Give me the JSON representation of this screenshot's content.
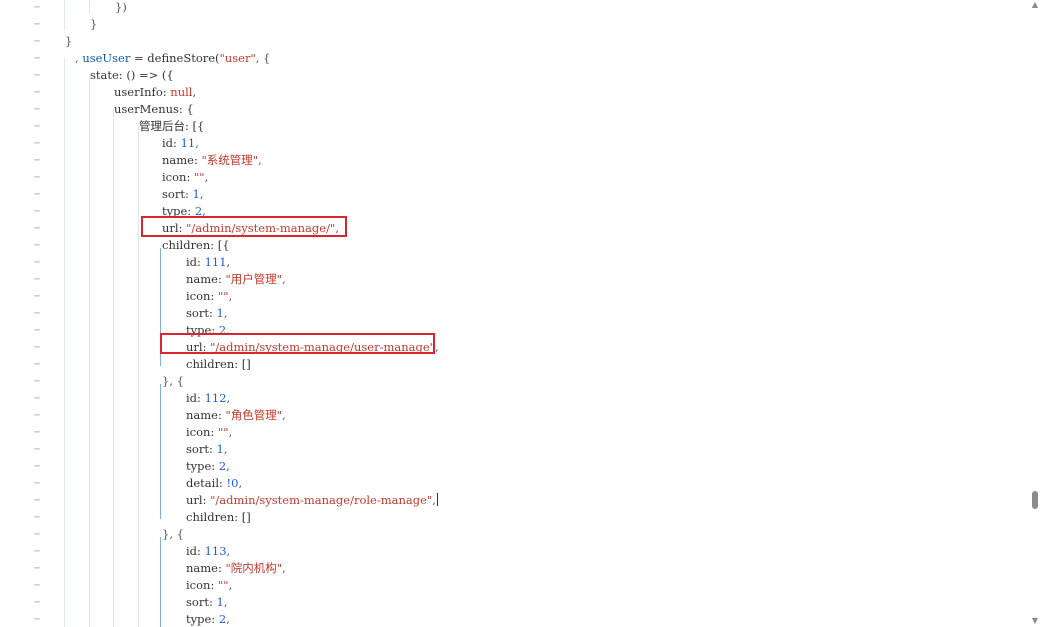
{
  "gutter_marker": "−",
  "scrollbar": {
    "up_glyph": "▲",
    "down_glyph": "▼"
  },
  "code": {
    "l1": "})",
    "l2": "}",
    "l3": "}",
    "l4": {
      "lead": ", ",
      "fn": "useUser",
      "mid": " = defineStore(",
      "str": "\"user\"",
      "tail": ", {"
    },
    "l5": "state: () => ({",
    "l6": {
      "key": "userInfo: ",
      "val": "null",
      "tail": ","
    },
    "l7": "userMenus: {",
    "l8": "管理后台: [{",
    "l9": {
      "key": "id: ",
      "val": "11",
      "tail": ","
    },
    "l10": {
      "key": "name: ",
      "val": "\"系统管理\"",
      "tail": ","
    },
    "l11": {
      "key": "icon: ",
      "val": "\"\"",
      "tail": ","
    },
    "l12": {
      "key": "sort: ",
      "val": "1",
      "tail": ","
    },
    "l13": {
      "key": "type: ",
      "val": "2",
      "tail": ","
    },
    "l14": {
      "key": "url: ",
      "val": "\"/admin/system-manage/\"",
      "tail": ","
    },
    "l15": "children: [{",
    "l16": {
      "key": "id: ",
      "val": "111",
      "tail": ","
    },
    "l17": {
      "key": "name: ",
      "val": "\"用户管理\"",
      "tail": ","
    },
    "l18": {
      "key": "icon: ",
      "val": "\"\"",
      "tail": ","
    },
    "l19": {
      "key": "sort: ",
      "val": "1",
      "tail": ","
    },
    "l20": {
      "key": "type: ",
      "val": "2",
      "tail": ","
    },
    "l21": {
      "key": "url: ",
      "val": "\"/admin/system-manage/user-manage\"",
      "tail": ","
    },
    "l22": "children: []",
    "l23": "}, {",
    "l24": {
      "key": "id: ",
      "val": "112",
      "tail": ","
    },
    "l25": {
      "key": "name: ",
      "val": "\"角色管理\"",
      "tail": ","
    },
    "l26": {
      "key": "icon: ",
      "val": "\"\"",
      "tail": ","
    },
    "l27": {
      "key": "sort: ",
      "val": "1",
      "tail": ","
    },
    "l28": {
      "key": "type: ",
      "val": "2",
      "tail": ","
    },
    "l29": {
      "key": "detail: ",
      "val": "!0",
      "tail": ","
    },
    "l30": {
      "key": "url: ",
      "val": "\"/admin/system-manage/role-manage\"",
      "tail": ","
    },
    "l31": "children: []",
    "l32": "}, {",
    "l33": {
      "key": "id: ",
      "val": "113",
      "tail": ","
    },
    "l34": {
      "key": "name: ",
      "val": "\"院内机构\"",
      "tail": ","
    },
    "l35": {
      "key": "icon: ",
      "val": "\"\"",
      "tail": ","
    },
    "l36": {
      "key": "sort: ",
      "val": "1",
      "tail": ","
    },
    "l37": {
      "key": "type: ",
      "val": "2",
      "tail": ","
    }
  }
}
